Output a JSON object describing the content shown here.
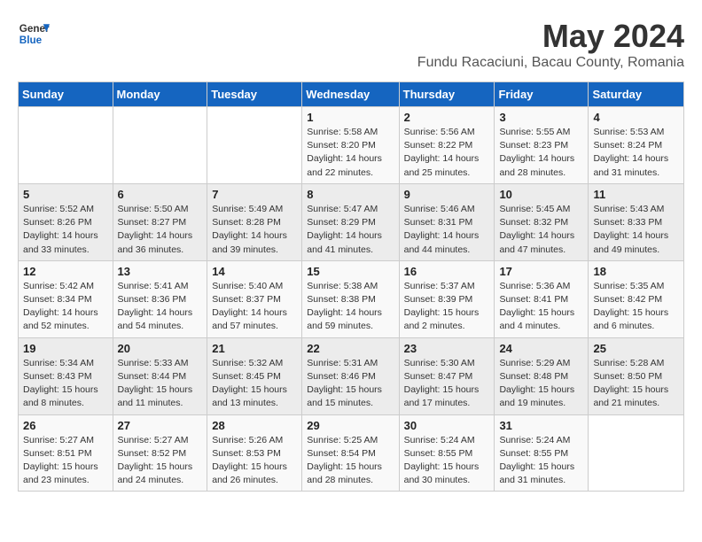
{
  "header": {
    "logo_general": "General",
    "logo_blue": "Blue",
    "month": "May 2024",
    "location": "Fundu Racaciuni, Bacau County, Romania"
  },
  "days_of_week": [
    "Sunday",
    "Monday",
    "Tuesday",
    "Wednesday",
    "Thursday",
    "Friday",
    "Saturday"
  ],
  "weeks": [
    [
      {
        "day": "",
        "info": ""
      },
      {
        "day": "",
        "info": ""
      },
      {
        "day": "",
        "info": ""
      },
      {
        "day": "1",
        "info": "Sunrise: 5:58 AM\nSunset: 8:20 PM\nDaylight: 14 hours\nand 22 minutes."
      },
      {
        "day": "2",
        "info": "Sunrise: 5:56 AM\nSunset: 8:22 PM\nDaylight: 14 hours\nand 25 minutes."
      },
      {
        "day": "3",
        "info": "Sunrise: 5:55 AM\nSunset: 8:23 PM\nDaylight: 14 hours\nand 28 minutes."
      },
      {
        "day": "4",
        "info": "Sunrise: 5:53 AM\nSunset: 8:24 PM\nDaylight: 14 hours\nand 31 minutes."
      }
    ],
    [
      {
        "day": "5",
        "info": "Sunrise: 5:52 AM\nSunset: 8:26 PM\nDaylight: 14 hours\nand 33 minutes."
      },
      {
        "day": "6",
        "info": "Sunrise: 5:50 AM\nSunset: 8:27 PM\nDaylight: 14 hours\nand 36 minutes."
      },
      {
        "day": "7",
        "info": "Sunrise: 5:49 AM\nSunset: 8:28 PM\nDaylight: 14 hours\nand 39 minutes."
      },
      {
        "day": "8",
        "info": "Sunrise: 5:47 AM\nSunset: 8:29 PM\nDaylight: 14 hours\nand 41 minutes."
      },
      {
        "day": "9",
        "info": "Sunrise: 5:46 AM\nSunset: 8:31 PM\nDaylight: 14 hours\nand 44 minutes."
      },
      {
        "day": "10",
        "info": "Sunrise: 5:45 AM\nSunset: 8:32 PM\nDaylight: 14 hours\nand 47 minutes."
      },
      {
        "day": "11",
        "info": "Sunrise: 5:43 AM\nSunset: 8:33 PM\nDaylight: 14 hours\nand 49 minutes."
      }
    ],
    [
      {
        "day": "12",
        "info": "Sunrise: 5:42 AM\nSunset: 8:34 PM\nDaylight: 14 hours\nand 52 minutes."
      },
      {
        "day": "13",
        "info": "Sunrise: 5:41 AM\nSunset: 8:36 PM\nDaylight: 14 hours\nand 54 minutes."
      },
      {
        "day": "14",
        "info": "Sunrise: 5:40 AM\nSunset: 8:37 PM\nDaylight: 14 hours\nand 57 minutes."
      },
      {
        "day": "15",
        "info": "Sunrise: 5:38 AM\nSunset: 8:38 PM\nDaylight: 14 hours\nand 59 minutes."
      },
      {
        "day": "16",
        "info": "Sunrise: 5:37 AM\nSunset: 8:39 PM\nDaylight: 15 hours\nand 2 minutes."
      },
      {
        "day": "17",
        "info": "Sunrise: 5:36 AM\nSunset: 8:41 PM\nDaylight: 15 hours\nand 4 minutes."
      },
      {
        "day": "18",
        "info": "Sunrise: 5:35 AM\nSunset: 8:42 PM\nDaylight: 15 hours\nand 6 minutes."
      }
    ],
    [
      {
        "day": "19",
        "info": "Sunrise: 5:34 AM\nSunset: 8:43 PM\nDaylight: 15 hours\nand 8 minutes."
      },
      {
        "day": "20",
        "info": "Sunrise: 5:33 AM\nSunset: 8:44 PM\nDaylight: 15 hours\nand 11 minutes."
      },
      {
        "day": "21",
        "info": "Sunrise: 5:32 AM\nSunset: 8:45 PM\nDaylight: 15 hours\nand 13 minutes."
      },
      {
        "day": "22",
        "info": "Sunrise: 5:31 AM\nSunset: 8:46 PM\nDaylight: 15 hours\nand 15 minutes."
      },
      {
        "day": "23",
        "info": "Sunrise: 5:30 AM\nSunset: 8:47 PM\nDaylight: 15 hours\nand 17 minutes."
      },
      {
        "day": "24",
        "info": "Sunrise: 5:29 AM\nSunset: 8:48 PM\nDaylight: 15 hours\nand 19 minutes."
      },
      {
        "day": "25",
        "info": "Sunrise: 5:28 AM\nSunset: 8:50 PM\nDaylight: 15 hours\nand 21 minutes."
      }
    ],
    [
      {
        "day": "26",
        "info": "Sunrise: 5:27 AM\nSunset: 8:51 PM\nDaylight: 15 hours\nand 23 minutes."
      },
      {
        "day": "27",
        "info": "Sunrise: 5:27 AM\nSunset: 8:52 PM\nDaylight: 15 hours\nand 24 minutes."
      },
      {
        "day": "28",
        "info": "Sunrise: 5:26 AM\nSunset: 8:53 PM\nDaylight: 15 hours\nand 26 minutes."
      },
      {
        "day": "29",
        "info": "Sunrise: 5:25 AM\nSunset: 8:54 PM\nDaylight: 15 hours\nand 28 minutes."
      },
      {
        "day": "30",
        "info": "Sunrise: 5:24 AM\nSunset: 8:55 PM\nDaylight: 15 hours\nand 30 minutes."
      },
      {
        "day": "31",
        "info": "Sunrise: 5:24 AM\nSunset: 8:55 PM\nDaylight: 15 hours\nand 31 minutes."
      },
      {
        "day": "",
        "info": ""
      }
    ]
  ]
}
